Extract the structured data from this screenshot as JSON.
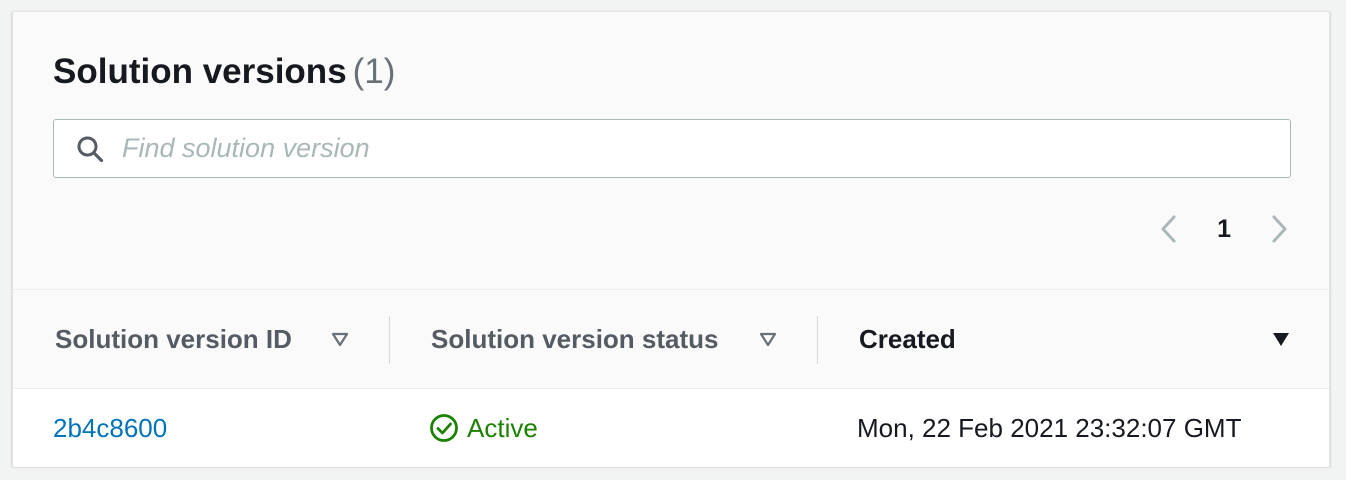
{
  "panel": {
    "title": "Solution versions",
    "count": "(1)"
  },
  "search": {
    "placeholder": "Find solution version",
    "value": ""
  },
  "pagination": {
    "current_page": "1"
  },
  "table": {
    "columns": [
      {
        "label": "Solution version ID",
        "sort": "sortable"
      },
      {
        "label": "Solution version status",
        "sort": "sortable"
      },
      {
        "label": "Created",
        "sort": "descending"
      }
    ],
    "rows": [
      {
        "id": "2b4c8600",
        "status": "Active",
        "created": "Mon, 22 Feb 2021 23:32:07 GMT"
      }
    ]
  },
  "colors": {
    "link": "#0073bb",
    "status_active": "#1d8102",
    "heading": "#16191f",
    "muted": "#687078"
  }
}
